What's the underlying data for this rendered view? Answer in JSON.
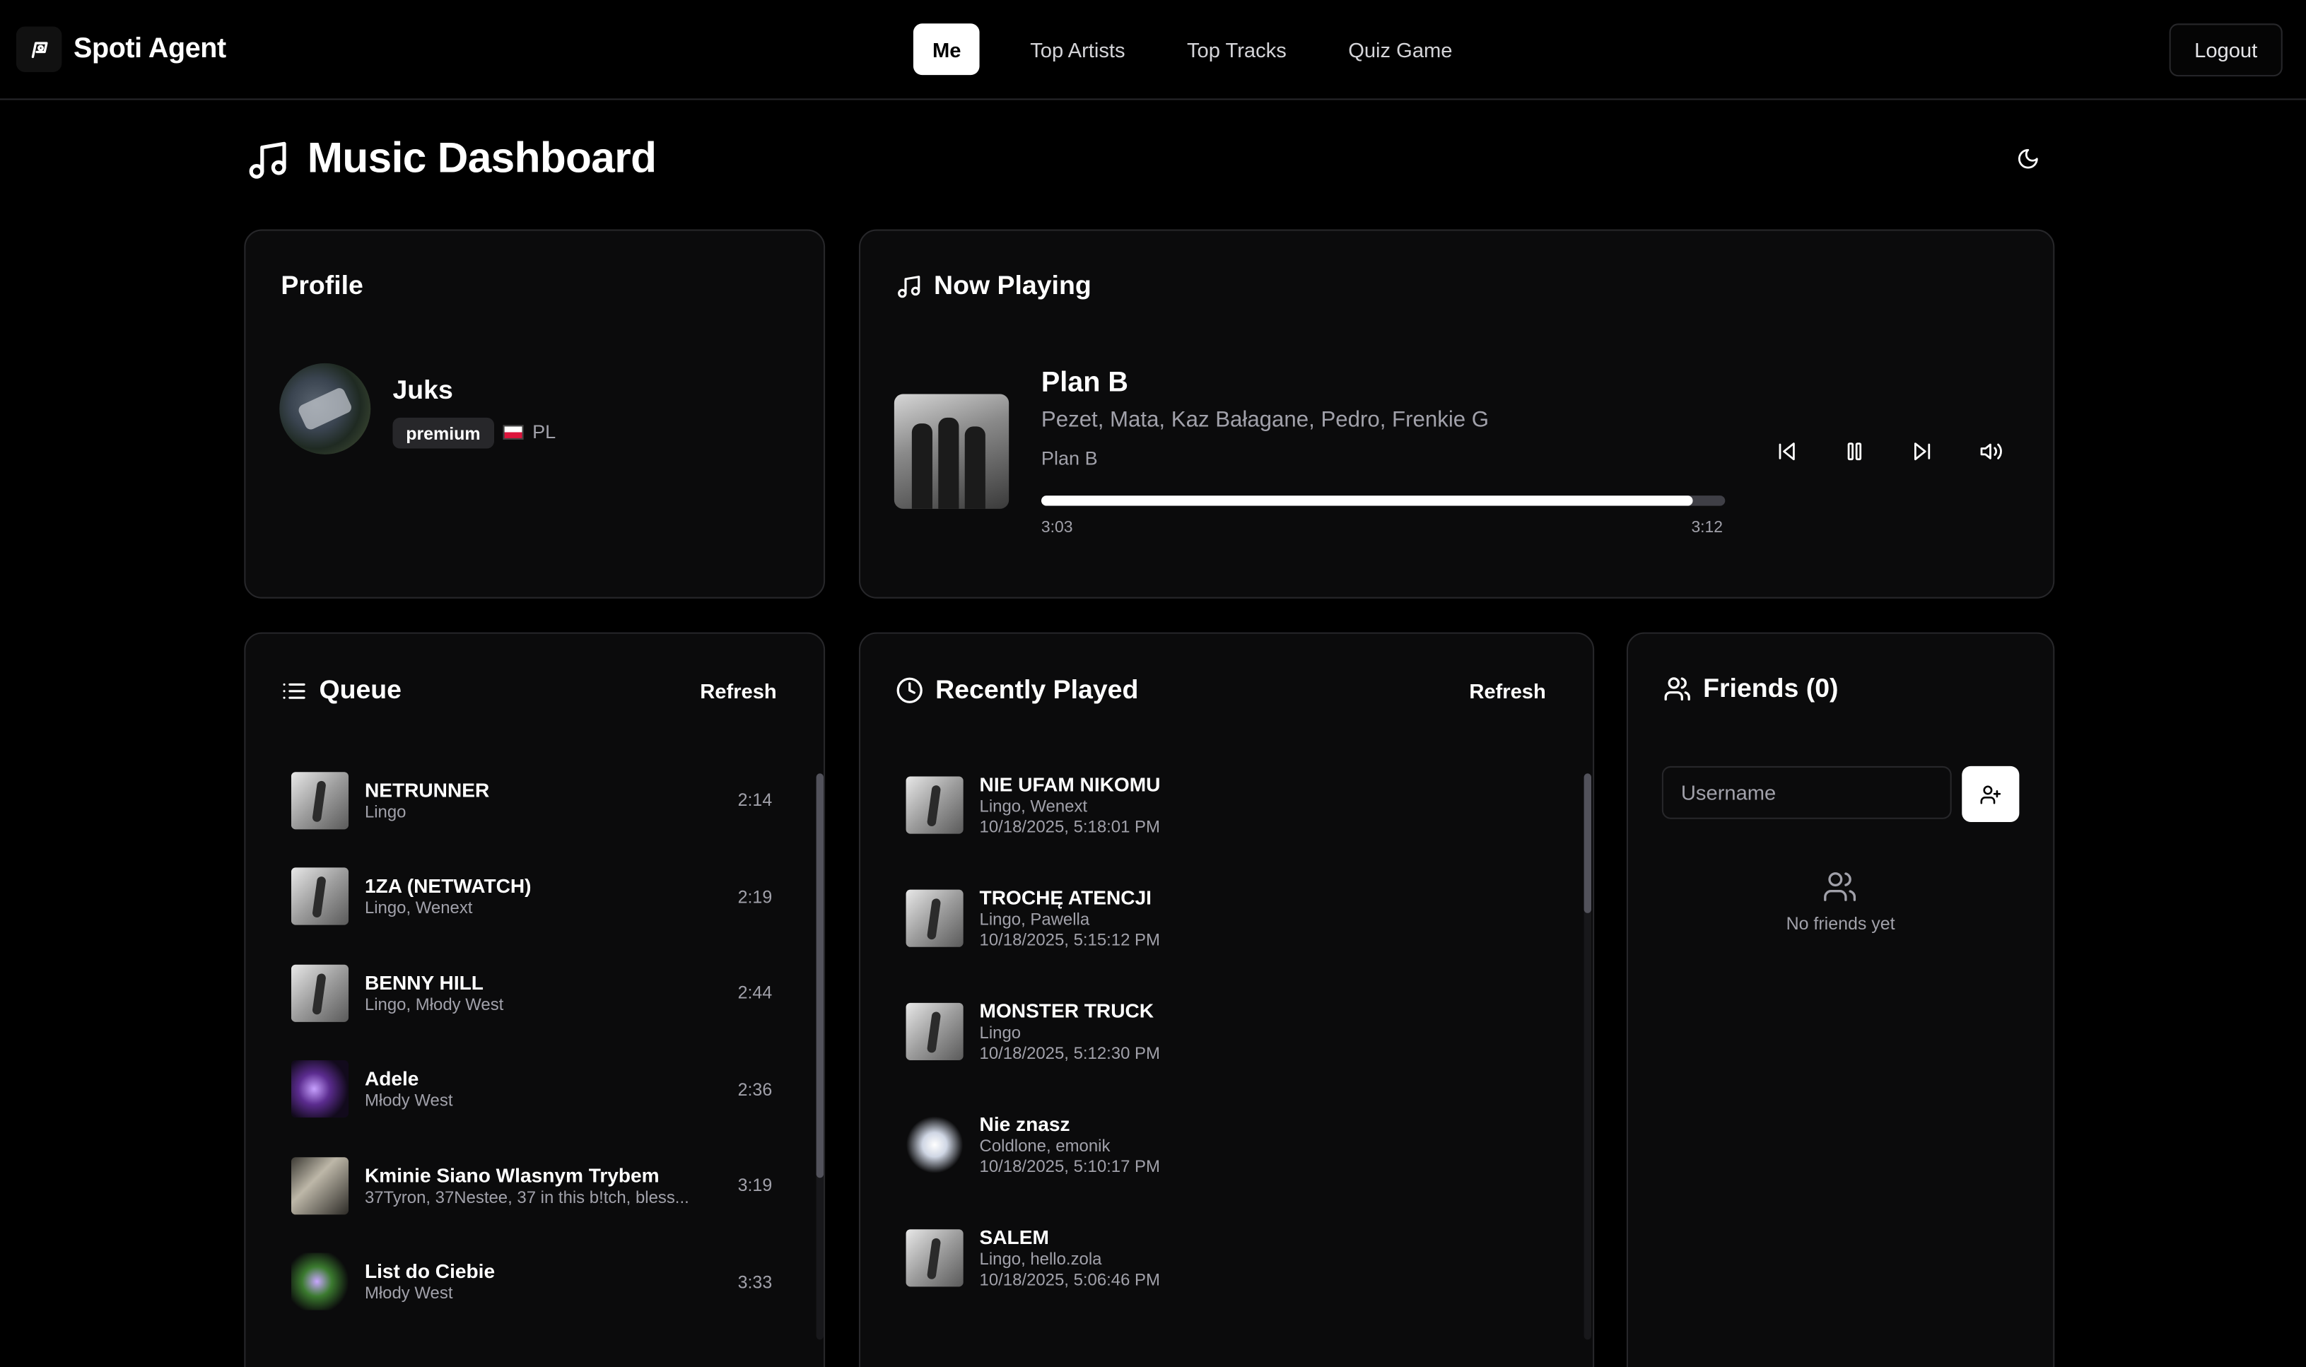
{
  "app": {
    "name": "Spoti Agent"
  },
  "nav": {
    "items": [
      "Me",
      "Top Artists",
      "Top Tracks",
      "Quiz Game"
    ],
    "active": "Me",
    "logout": "Logout"
  },
  "page": {
    "title": "Music Dashboard"
  },
  "profile": {
    "title": "Profile",
    "name": "Juks",
    "plan": "premium",
    "country": "PL"
  },
  "now_playing": {
    "title": "Now Playing",
    "track": "Plan B",
    "artists": "Pezet, Mata, Kaz Bałagane, Pedro, Frenkie G",
    "album": "Plan B",
    "elapsed": "3:03",
    "duration": "3:12",
    "progress_fraction": 0.953
  },
  "queue": {
    "title": "Queue",
    "refresh": "Refresh",
    "items": [
      {
        "title": "NETRUNNER",
        "artists": "Lingo",
        "duration": "2:14",
        "art": "bw"
      },
      {
        "title": "1ZA (NETWATCH)",
        "artists": "Lingo, Wenext",
        "duration": "2:19",
        "art": "bw"
      },
      {
        "title": "BENNY HILL",
        "artists": "Lingo, Młody West",
        "duration": "2:44",
        "art": "bw"
      },
      {
        "title": "Adele",
        "artists": "Młody West",
        "duration": "2:36",
        "art": "purple"
      },
      {
        "title": "Kminie Siano Wlasnym Trybem",
        "artists": "37Tyron, 37Nestee, 37 in this b!tch, bless...",
        "duration": "3:19",
        "art": "photo"
      },
      {
        "title": "List do Ciebie",
        "artists": "Młody West",
        "duration": "3:33",
        "art": "green"
      }
    ]
  },
  "recently_played": {
    "title": "Recently Played",
    "refresh": "Refresh",
    "items": [
      {
        "title": "NIE UFAM NIKOMU",
        "artists": "Lingo, Wenext",
        "played_at": "10/18/2025, 5:18:01 PM",
        "art": "bw"
      },
      {
        "title": "TROCHĘ ATENCJI",
        "artists": "Lingo, Pawella",
        "played_at": "10/18/2025, 5:15:12 PM",
        "art": "bw"
      },
      {
        "title": "MONSTER TRUCK",
        "artists": "Lingo",
        "played_at": "10/18/2025, 5:12:30 PM",
        "art": "bw"
      },
      {
        "title": "Nie znasz",
        "artists": "Coldlone, emonik",
        "played_at": "10/18/2025, 5:10:17 PM",
        "art": "flower"
      },
      {
        "title": "SALEM",
        "artists": "Lingo, hello.zola",
        "played_at": "10/18/2025, 5:06:46 PM",
        "art": "bw"
      }
    ]
  },
  "friends": {
    "title": "Friends (0)",
    "placeholder": "Username",
    "empty": "No friends yet"
  }
}
